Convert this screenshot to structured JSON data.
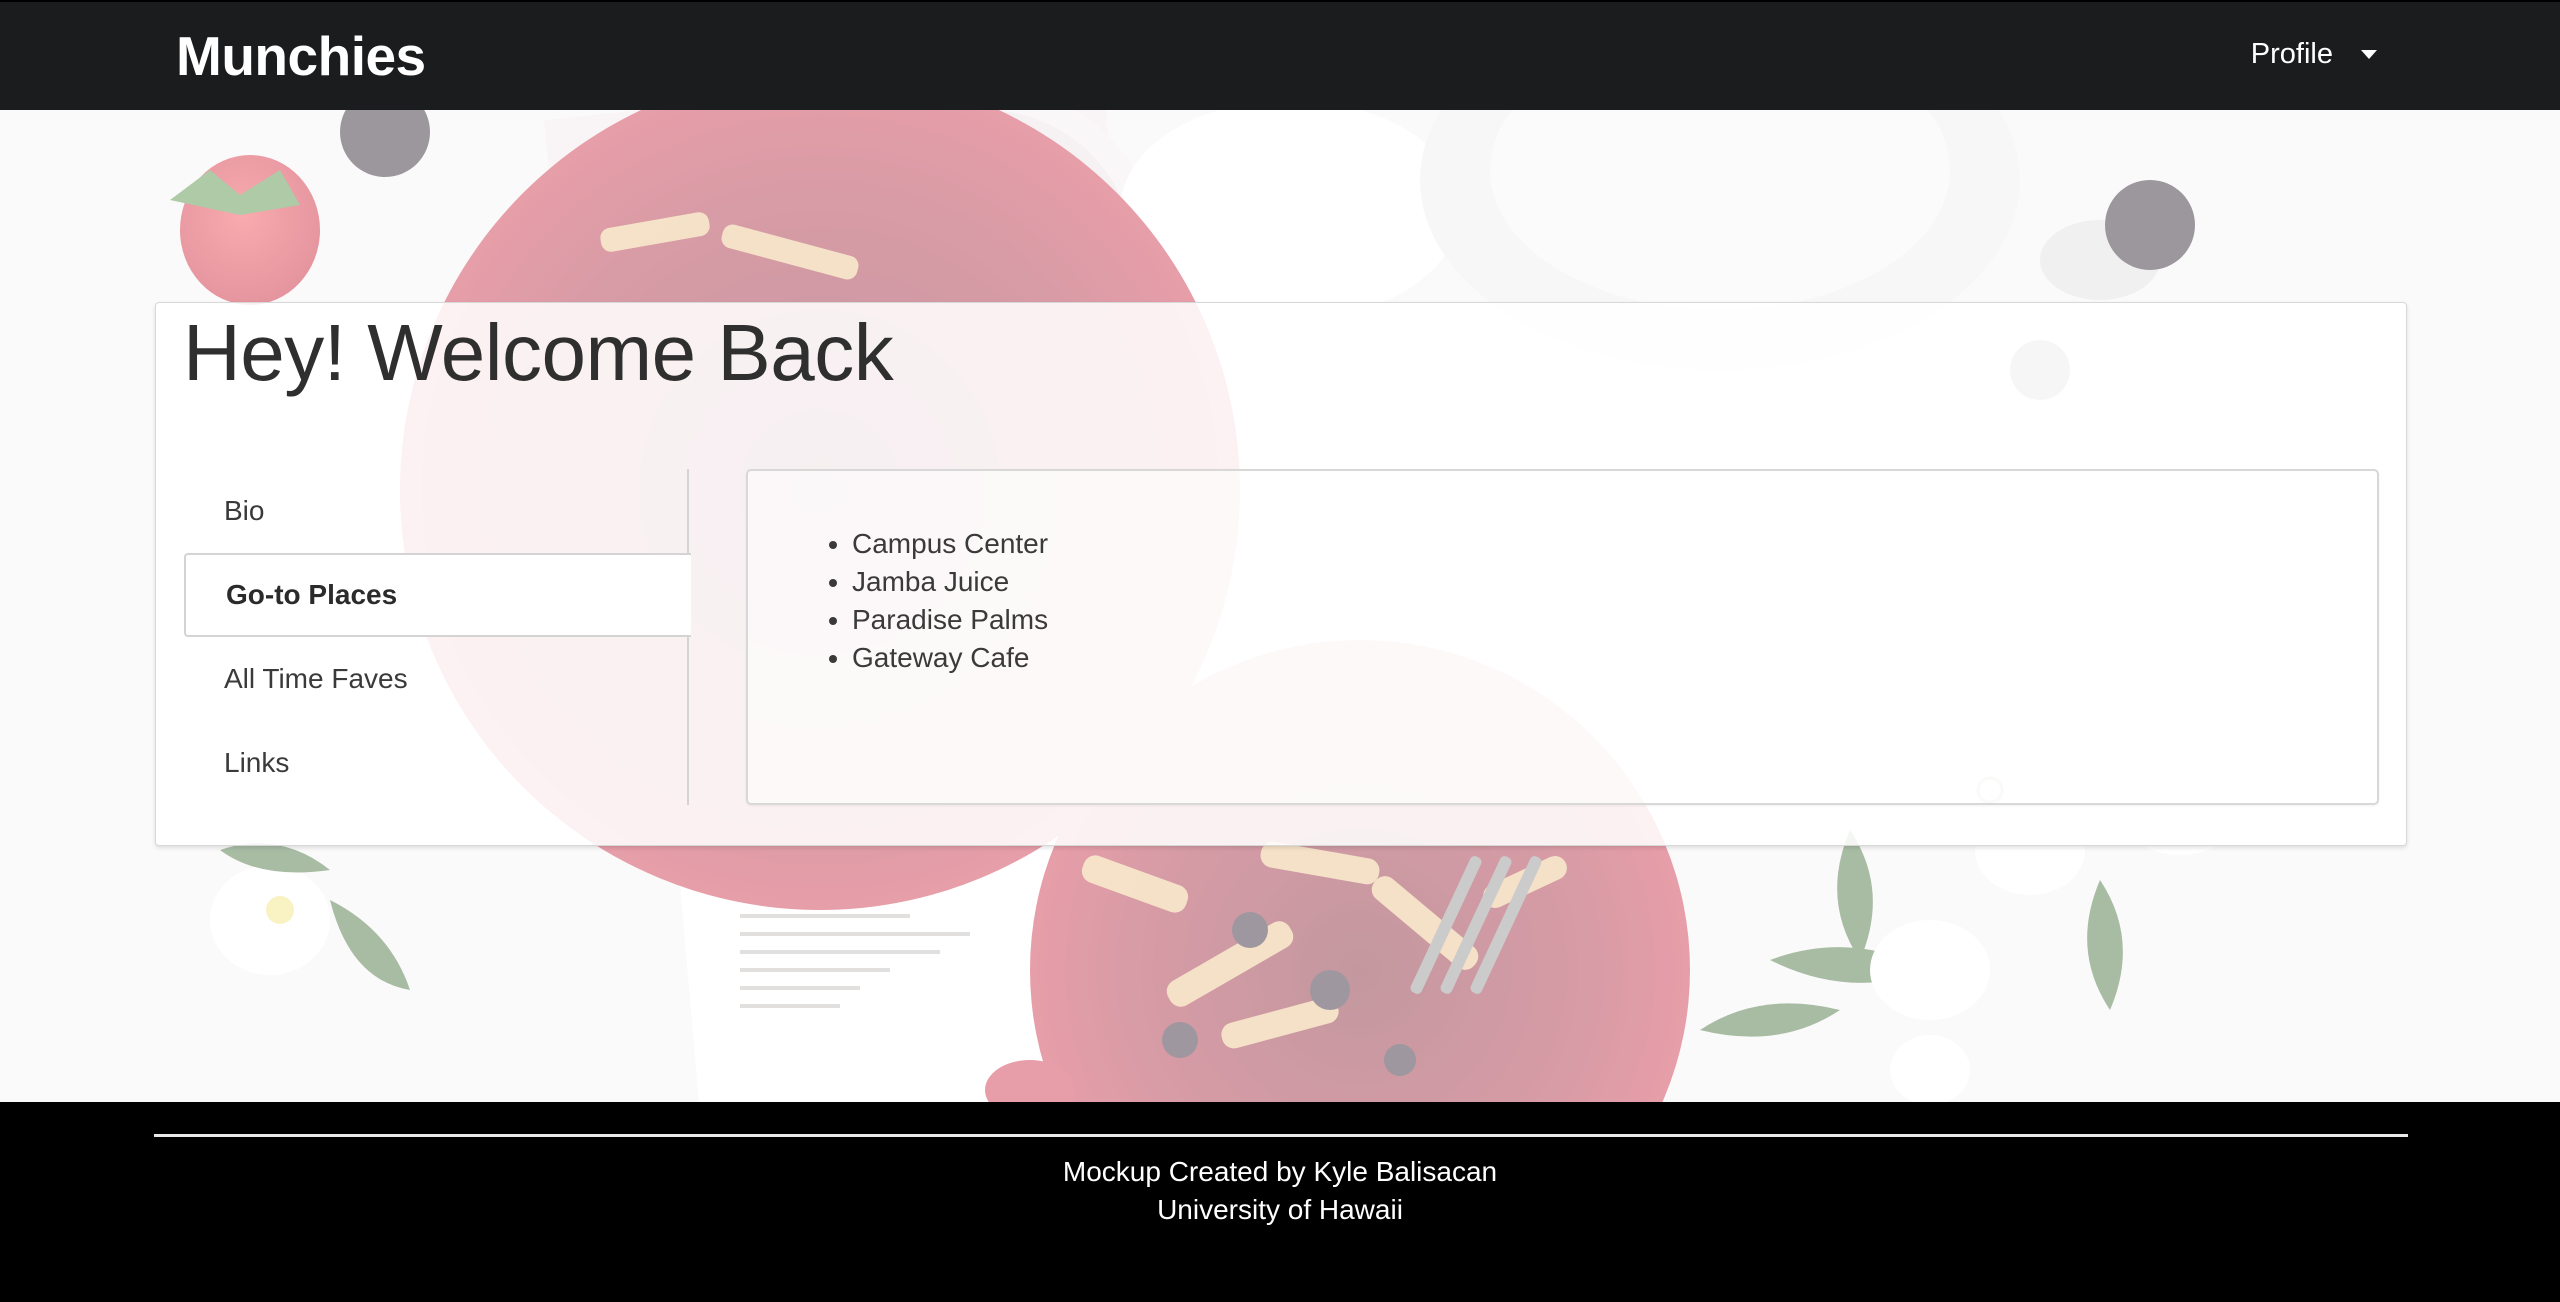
{
  "navbar": {
    "brand": "Munchies",
    "profile_label": "Profile",
    "profile_caret_icon": "caret-down-icon"
  },
  "hero": {
    "background_description_icon": "food-table-photo"
  },
  "card": {
    "title": "Hey! Welcome Back",
    "tabs": [
      {
        "label": "Bio",
        "active": false
      },
      {
        "label": "Go-to Places",
        "active": true
      },
      {
        "label": "All Time Faves",
        "active": false
      },
      {
        "label": "Links",
        "active": false
      }
    ],
    "places": [
      "Campus Center",
      "Jamba Juice",
      "Paradise Palms",
      "Gateway Cafe"
    ]
  },
  "footer": {
    "line1": "Mockup Created by Kyle Balisacan",
    "line2": "University of Hawaii"
  },
  "colors": {
    "navbar_bg": "#1b1c1d",
    "footer_bg": "#000000",
    "text": "#3a3a3a"
  }
}
